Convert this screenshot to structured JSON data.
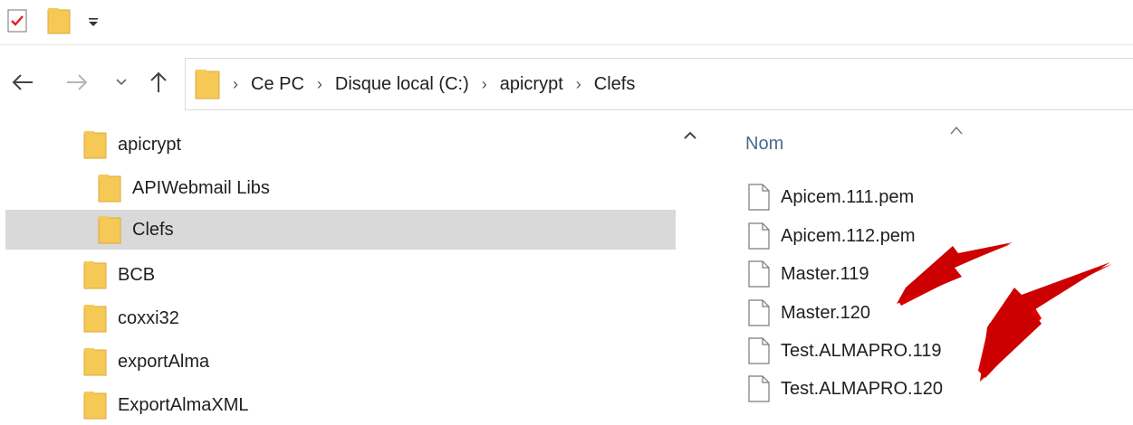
{
  "window": {
    "quick_access": [
      {
        "name": "properties-check-icon"
      },
      {
        "name": "new-folder-icon"
      },
      {
        "name": "customize-dropdown-icon"
      }
    ]
  },
  "address": {
    "breadcrumbs": [
      "Ce PC",
      "Disque local (C:)",
      "apicrypt",
      "Clefs"
    ]
  },
  "nav_pane": {
    "items": [
      {
        "label": "apicrypt",
        "level": 0,
        "selected": false
      },
      {
        "label": "APIWebmail Libs",
        "level": 1,
        "selected": false
      },
      {
        "label": "Clefs",
        "level": 1,
        "selected": true
      },
      {
        "label": "BCB",
        "level": 0,
        "selected": false
      },
      {
        "label": "coxxi32",
        "level": 0,
        "selected": false
      },
      {
        "label": "exportAlma",
        "level": 0,
        "selected": false
      },
      {
        "label": "ExportAlmaXML",
        "level": 0,
        "selected": false
      }
    ]
  },
  "file_list": {
    "column_header": "Nom",
    "files": [
      "Apicem.111.pem",
      "Apicem.112.pem",
      "Master.119",
      "Master.120",
      "Test.ALMAPRO.119",
      "Test.ALMAPRO.120"
    ]
  },
  "colors": {
    "folder": "#f6c957",
    "selection": "#d9d9d9",
    "annotation_arrow": "#e00000",
    "header_text": "#4a6a8a"
  }
}
